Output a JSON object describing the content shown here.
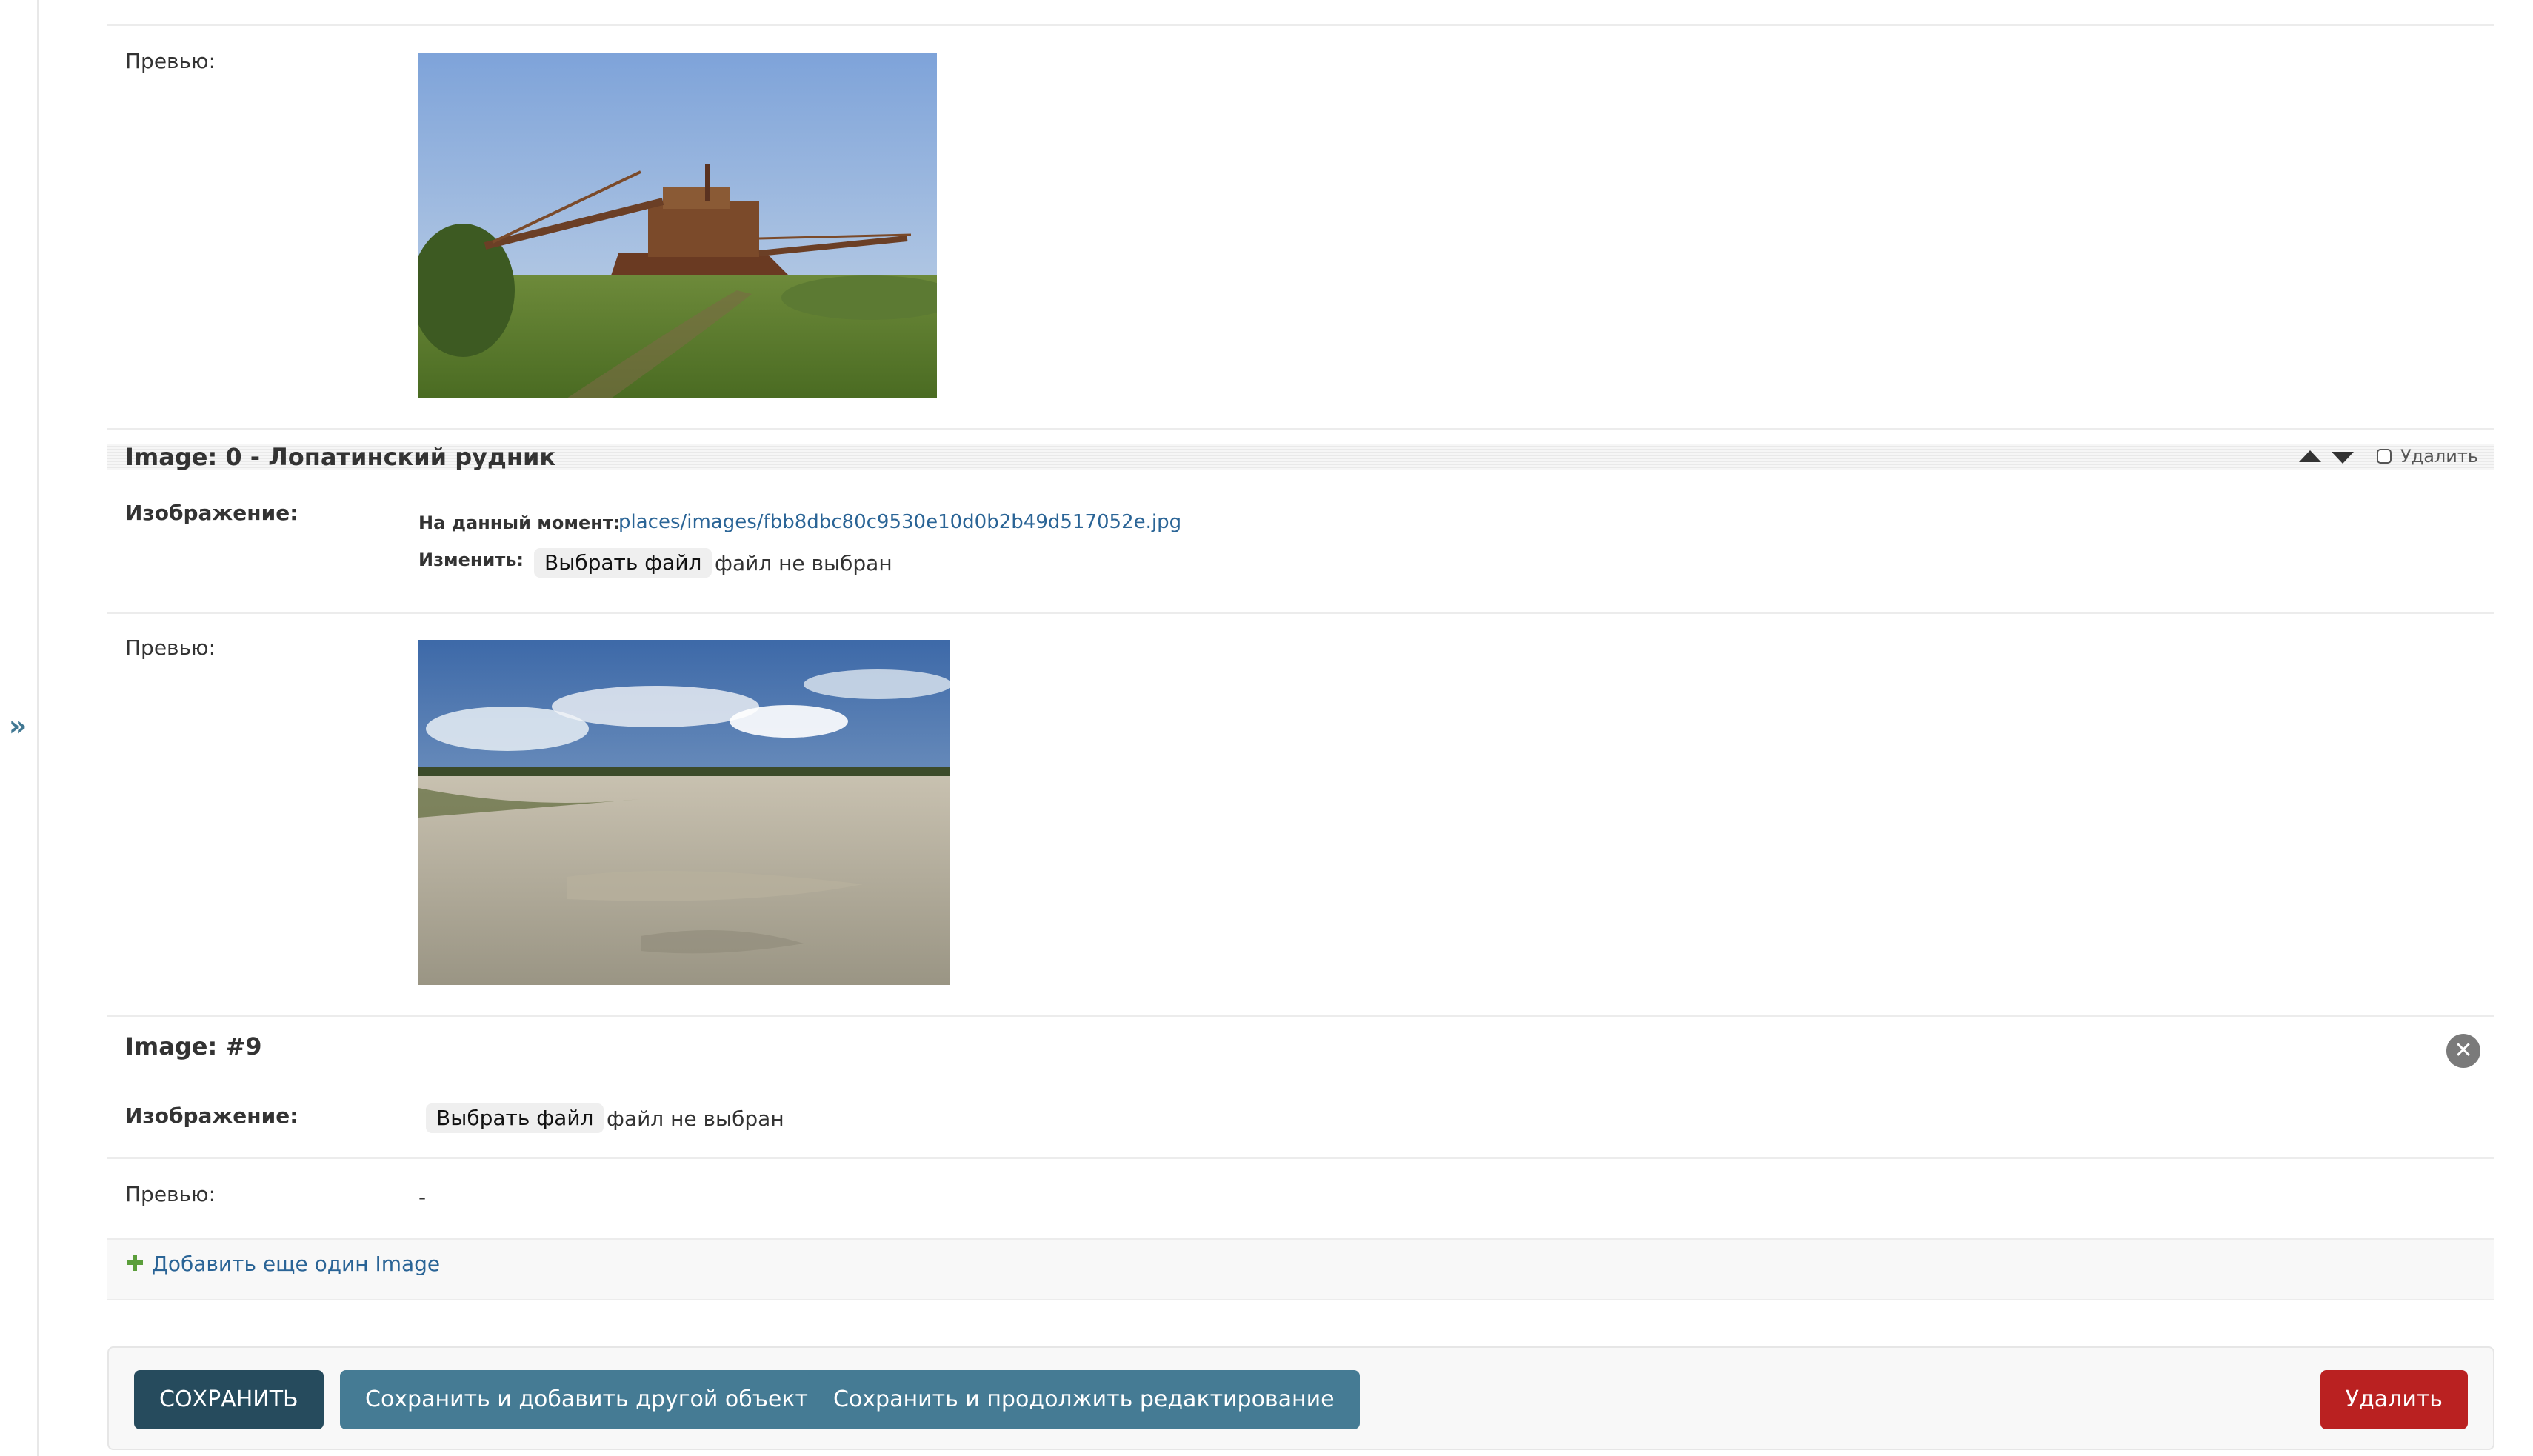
{
  "sidebar": {
    "toggle_glyph": "»",
    "toggle_icon": "double-chevron-right-icon"
  },
  "fields": {
    "preview_label": "Превью:",
    "image_label": "Изображение:",
    "current_label": "На данный момент:",
    "change_label": "Изменить:",
    "choose_file_label": "Выбрать файл",
    "no_file_label": "файл не выбран",
    "empty_preview": "-"
  },
  "inline_1": {
    "title": "Image: 0 - Лопатинский рудник",
    "delete_label": "Удалить",
    "current_file": "places/images/fbb8dbc80c9530e10d0b2b49d517052e.jpg"
  },
  "inline_new": {
    "title": "Image: #9",
    "remove_icon": "remove-circle-icon"
  },
  "add_another": {
    "label": "Добавить еще один Image",
    "icon": "plus-icon"
  },
  "submit_row": {
    "save_label": "СОХРАНИТЬ",
    "save_add_label": "Сохранить и добавить другой объект",
    "save_continue_label": "Сохранить и продолжить редактирование",
    "delete_label": "Удалить"
  },
  "colors": {
    "link": "#2a6496",
    "primary_button": "#264b5d",
    "secondary_button": "#457b94",
    "danger_button": "#ba2121",
    "add_plus": "#5b9e3b"
  }
}
